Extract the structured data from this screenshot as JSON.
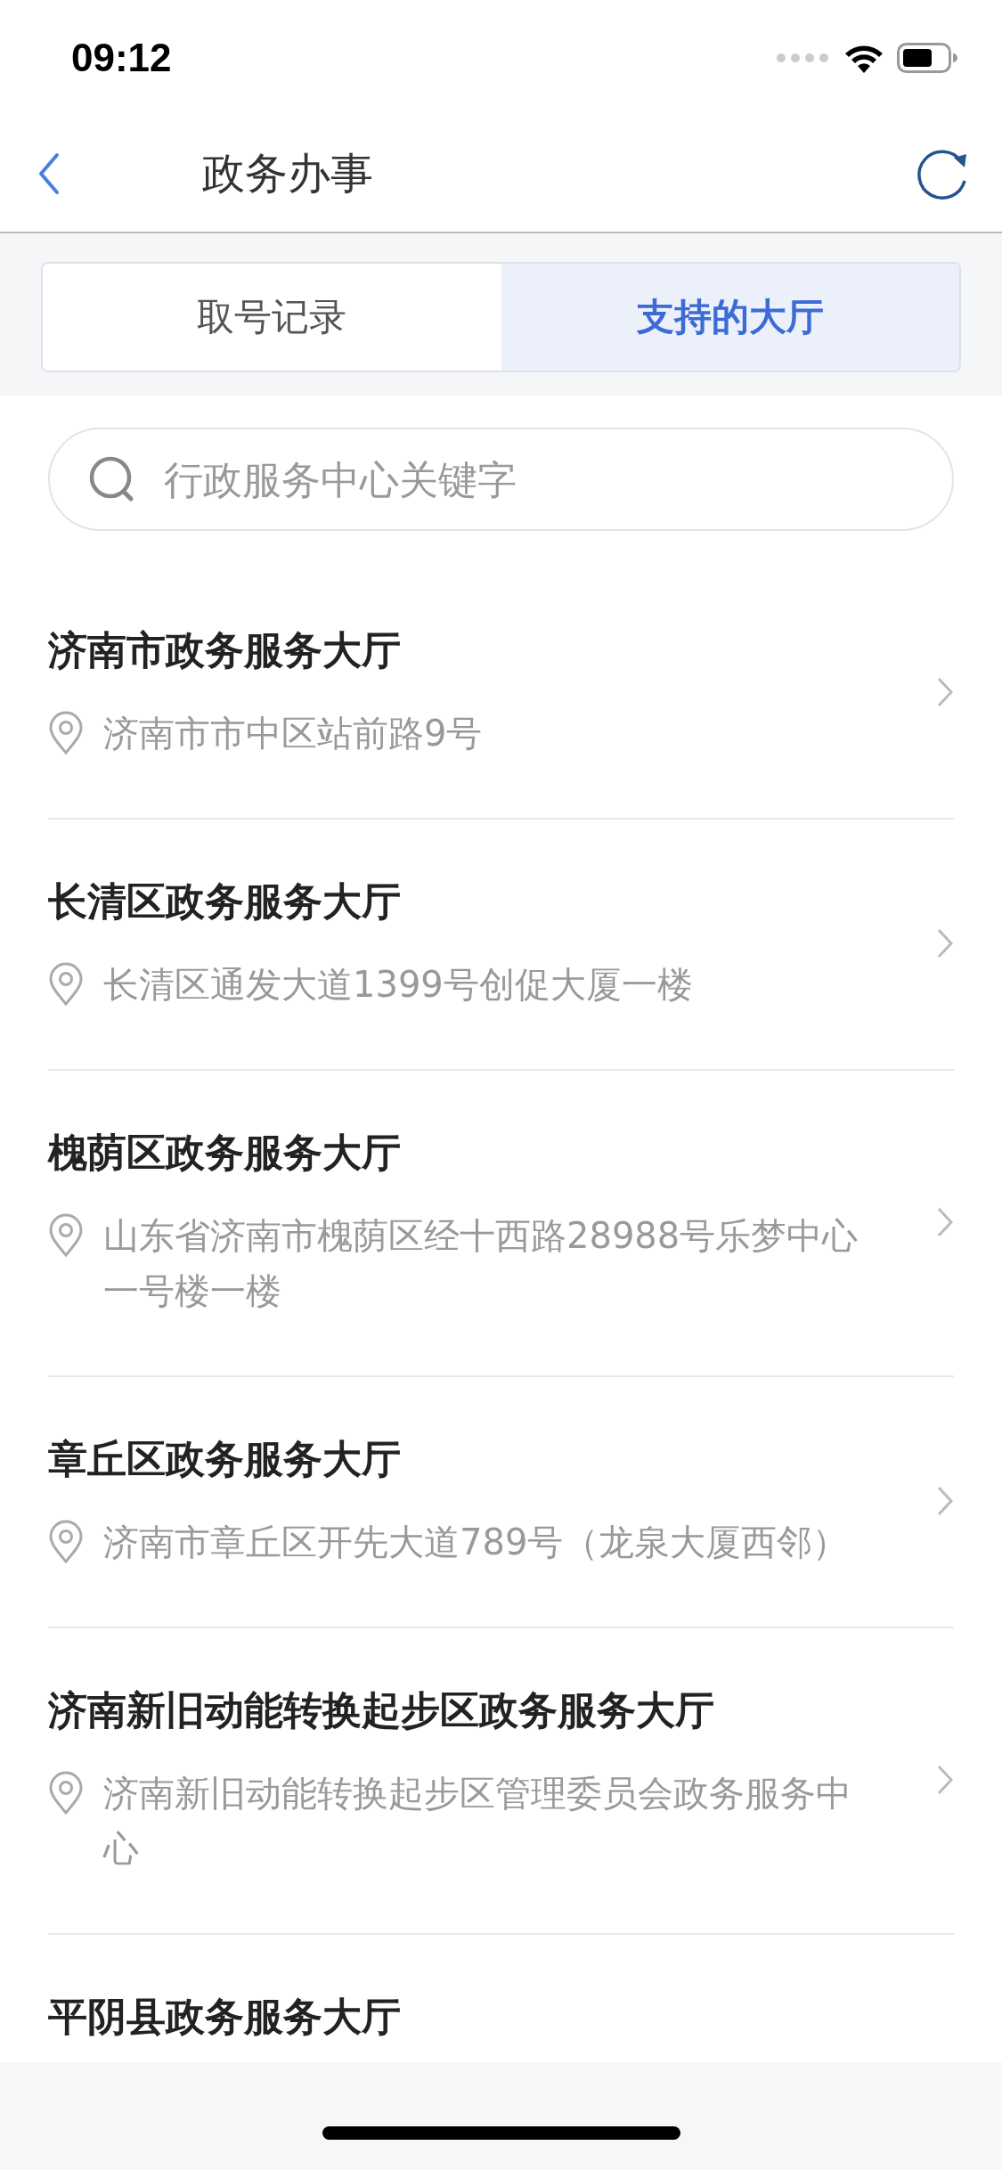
{
  "status_bar": {
    "time": "09:12"
  },
  "nav": {
    "title": "政务办事"
  },
  "tabs": [
    {
      "label": "取号记录",
      "selected": false
    },
    {
      "label": "支持的大厅",
      "selected": true
    }
  ],
  "search": {
    "placeholder": "行政服务中心关键字"
  },
  "halls": [
    {
      "name": "济南市政务服务大厅",
      "address": "济南市市中区站前路9号"
    },
    {
      "name": "长清区政务服务大厅",
      "address": "长清区通发大道1399号创促大厦一楼"
    },
    {
      "name": "槐荫区政务服务大厅",
      "address": "山东省济南市槐荫区经十西路28988号乐梦中心一号楼一楼"
    },
    {
      "name": "章丘区政务服务大厅",
      "address": "济南市章丘区开先大道789号（龙泉大厦西邻）"
    },
    {
      "name": "济南新旧动能转换起步区政务服务大厅",
      "address": "济南新旧动能转换起步区管理委员会政务服务中心"
    },
    {
      "name": "平阴县政务服务大厅"
    }
  ]
}
